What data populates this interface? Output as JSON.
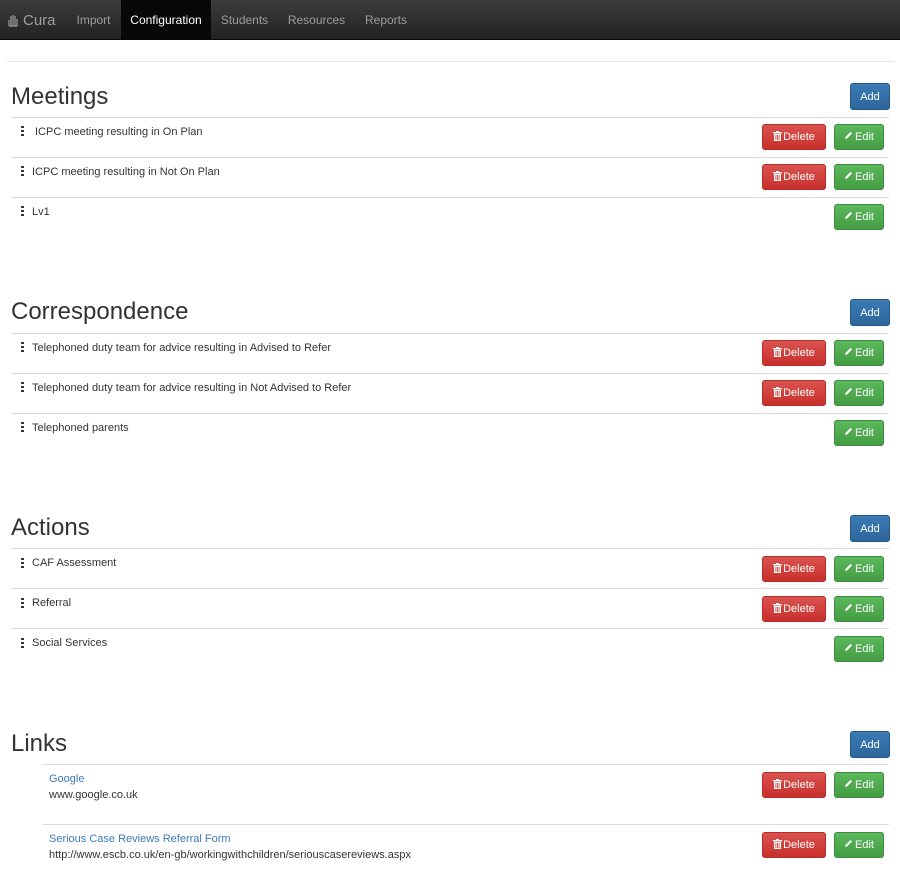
{
  "navbar": {
    "brand": "Cura",
    "brand_icon": "hand-icon",
    "items": [
      {
        "label": "Import"
      },
      {
        "label": "Configuration",
        "active": true
      },
      {
        "label": "Students"
      },
      {
        "label": "Resources"
      },
      {
        "label": "Reports"
      }
    ]
  },
  "buttons": {
    "add": "Add",
    "delete": "Delete",
    "edit": "Edit"
  },
  "meetings": {
    "title": "Meetings",
    "items": [
      {
        "label": "ICPC meeting resulting in On Plan",
        "deletable": true
      },
      {
        "label": "ICPC meeting resulting in Not On Plan",
        "deletable": true
      },
      {
        "label": "Lv1",
        "deletable": false
      }
    ]
  },
  "correspondence": {
    "title": "Correspondence",
    "items": [
      {
        "label": "Telephoned duty team for advice resulting in Advised to Refer",
        "deletable": true
      },
      {
        "label": "Telephoned duty team for advice resulting in Not Advised to Refer",
        "deletable": true
      },
      {
        "label": "Telephoned parents",
        "deletable": false
      }
    ]
  },
  "actions": {
    "title": "Actions",
    "items": [
      {
        "label": "CAF Assessment",
        "deletable": true
      },
      {
        "label": "Referral",
        "deletable": true
      },
      {
        "label": "Social Services",
        "deletable": false
      }
    ]
  },
  "links": {
    "title": "Links",
    "items": [
      {
        "title": "Google",
        "url": "www.google.co.uk"
      },
      {
        "title": "Serious Case Reviews Referral Form",
        "url": "http://www.escb.co.uk/en-gb/workingwithchildren/seriouscasereviews.aspx"
      }
    ]
  },
  "colors": {
    "add": "#2d6699",
    "delete": "#d9534f",
    "edit": "#5cb85c",
    "link": "#3a7ab7",
    "navbar": "#222222"
  }
}
